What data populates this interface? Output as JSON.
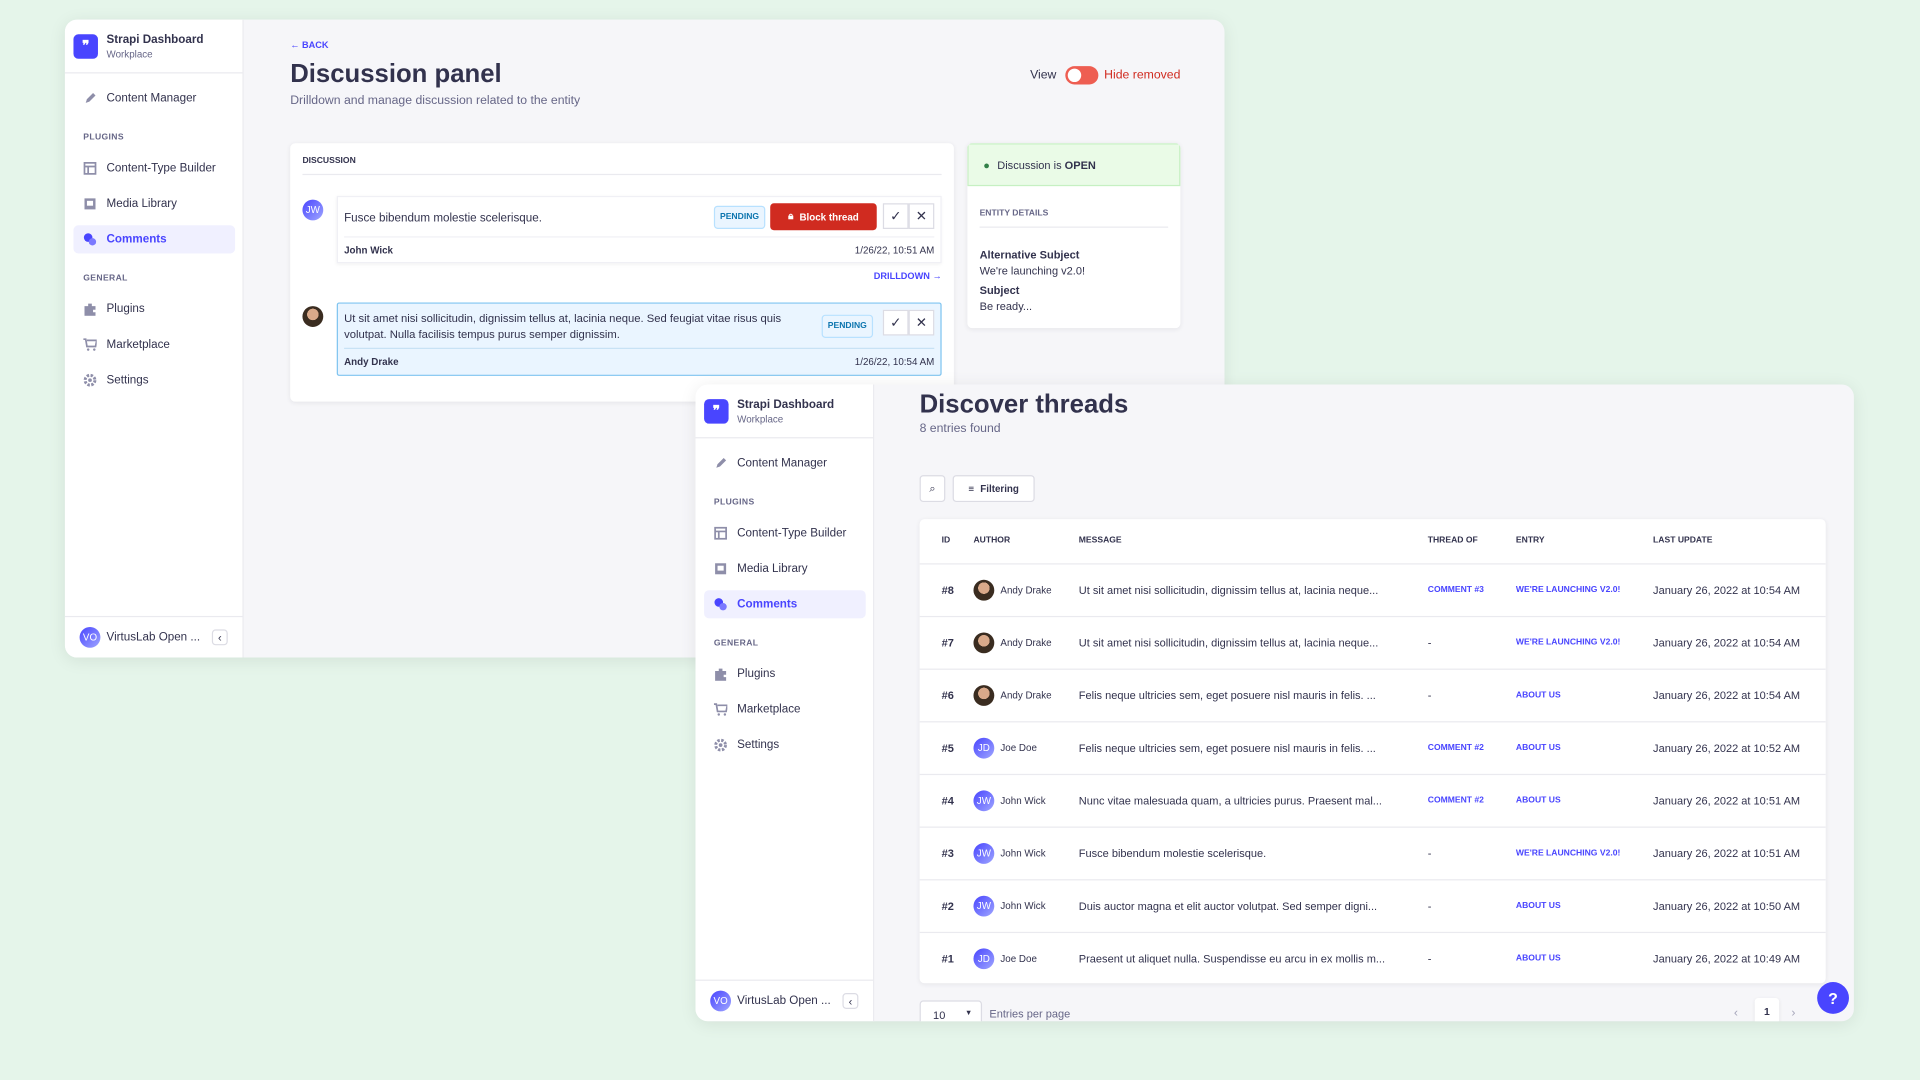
{
  "sidebar": {
    "brand_title": "Strapi Dashboard",
    "brand_subtitle": "Workplace",
    "content_manager": "Content Manager",
    "plugins_label": "PLUGINS",
    "content_type_builder": "Content-Type Builder",
    "media_library": "Media Library",
    "comments": "Comments",
    "general_label": "GENERAL",
    "plugins": "Plugins",
    "marketplace": "Marketplace",
    "settings": "Settings",
    "user_initials": "VO",
    "user_name": "VirtusLab Open ...",
    "collapse_icon": "chevron-left"
  },
  "discussion_panel": {
    "back": "BACK",
    "title": "Discussion panel",
    "subtitle": "Drilldown and manage discussion related to the entity",
    "view_label": "View",
    "toggle_label": "Hide removed",
    "toggle_color": "#ee5e52",
    "section_label": "DISCUSSION",
    "comments": [
      {
        "initials": "JW",
        "text": "Fusce bibendum molestie scelerisque.",
        "status": "PENDING",
        "block_label": "Block thread",
        "author": "John Wick",
        "date": "1/26/22, 10:51 AM"
      },
      {
        "initials": "",
        "text": "Ut sit amet nisi sollicitudin, dignissim tellus at, lacinia neque. Sed feugiat vitae risus quis volutpat. Nulla facilisis tempus purus semper dignissim.",
        "status": "PENDING",
        "author": "Andy Drake",
        "date": "1/26/22, 10:54 AM"
      }
    ],
    "drilldown": "DRILLDOWN",
    "status_text": "Discussion is ",
    "status_value": "OPEN",
    "entity_details_label": "ENTITY DETAILS",
    "alt_subject_label": "Alternative Subject",
    "alt_subject_value": "We're launching v2.0!",
    "subject_label": "Subject",
    "subject_value": "Be ready..."
  },
  "threads": {
    "title": "Discover threads",
    "subtitle": "8 entries found",
    "filter_label": "Filtering",
    "columns": [
      "ID",
      "AUTHOR",
      "MESSAGE",
      "THREAD OF",
      "ENTRY",
      "LAST UPDATE"
    ],
    "rows": [
      {
        "id": "#8",
        "initials": "",
        "author": "Andy Drake",
        "message": "Ut sit amet nisi sollicitudin, dignissim tellus at, lacinia neque...",
        "thread_of": "COMMENT #3",
        "entry": "WE'RE LAUNCHING V2.0!",
        "updated": "January 26, 2022 at 10:54 AM"
      },
      {
        "id": "#7",
        "initials": "",
        "author": "Andy Drake",
        "message": "Ut sit amet nisi sollicitudin, dignissim tellus at, lacinia neque...",
        "thread_of": "-",
        "entry": "WE'RE LAUNCHING V2.0!",
        "updated": "January 26, 2022 at 10:54 AM"
      },
      {
        "id": "#6",
        "initials": "",
        "author": "Andy Drake",
        "message": "Felis neque ultricies sem, eget posuere nisl mauris in felis. ...",
        "thread_of": "-",
        "entry": "ABOUT US",
        "updated": "January 26, 2022 at 10:54 AM"
      },
      {
        "id": "#5",
        "initials": "JD",
        "author": "Joe Doe",
        "message": "Felis neque ultricies sem, eget posuere nisl mauris in felis. ...",
        "thread_of": "COMMENT #2",
        "entry": "ABOUT US",
        "updated": "January 26, 2022 at 10:52 AM"
      },
      {
        "id": "#4",
        "initials": "JW",
        "author": "John Wick",
        "message": "Nunc vitae malesuada quam, a ultricies purus. Praesent mal...",
        "thread_of": "COMMENT #2",
        "entry": "ABOUT US",
        "updated": "January 26, 2022 at 10:51 AM"
      },
      {
        "id": "#3",
        "initials": "JW",
        "author": "John Wick",
        "message": "Fusce bibendum molestie scelerisque.",
        "thread_of": "-",
        "entry": "WE'RE LAUNCHING V2.0!",
        "updated": "January 26, 2022 at 10:51 AM"
      },
      {
        "id": "#2",
        "initials": "JW",
        "author": "John Wick",
        "message": "Duis auctor magna et elit auctor volutpat. Sed semper digni...",
        "thread_of": "-",
        "entry": "ABOUT US",
        "updated": "January 26, 2022 at 10:50 AM"
      },
      {
        "id": "#1",
        "initials": "JD",
        "author": "Joe Doe",
        "message": "Praesent ut aliquet nulla. Suspendisse eu arcu in ex mollis m...",
        "thread_of": "-",
        "entry": "ABOUT US",
        "updated": "January 26, 2022 at 10:49 AM"
      }
    ],
    "per_page": "10",
    "per_page_label": "Entries per page",
    "current_page": "1",
    "help": "?"
  },
  "colors": {
    "accent": "#4945ff",
    "danger": "#d02b20",
    "success_bg": "#eafbe7",
    "background": "#e5f5ea"
  }
}
